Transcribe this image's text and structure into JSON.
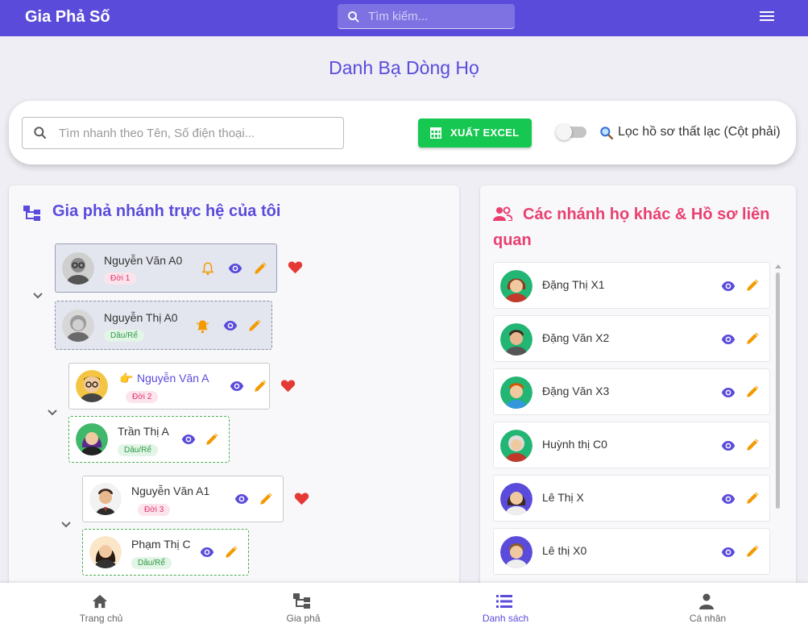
{
  "app": {
    "title": "Gia Phả Số",
    "search_placeholder": "Tìm kiếm..."
  },
  "page": {
    "title": "Danh Bạ Dòng Họ"
  },
  "toolbar": {
    "quick_search_placeholder": "Tìm nhanh theo Tên, Số điện thoại...",
    "excel_label": "XUẤT EXCEL",
    "filter_label": "Lọc hồ sơ thất lạc (Cột phải)",
    "filter_on": false
  },
  "tree": {
    "heading": "Gia phả nhánh trực hệ của tôi",
    "nodes": [
      {
        "name": "Nguyễn Văn A0",
        "badge": "Đời 1",
        "spouse_name": "Nguyễn Thị A0",
        "spouse_badge": "Dâu/Rể"
      },
      {
        "name": "Nguyễn Văn A",
        "pointer": "👉",
        "badge": "Đời 2",
        "spouse_name": "Trần Thị A",
        "spouse_badge": "Dâu/Rể"
      },
      {
        "name": "Nguyễn Văn A1",
        "badge": "Đời 3",
        "spouse_name": "Phạm Thị C",
        "spouse_badge": "Dâu/Rể"
      }
    ]
  },
  "related": {
    "heading": "Các nhánh họ khác & Hồ sơ liên quan",
    "items": [
      {
        "name": "Đặng Thị X1"
      },
      {
        "name": "Đặng Văn X2"
      },
      {
        "name": "Đặng Văn X3"
      },
      {
        "name": "Huỳnh thị C0"
      },
      {
        "name": "Lê Thị X"
      },
      {
        "name": "Lê thị X0"
      }
    ]
  },
  "nav": [
    {
      "label": "Trang chủ",
      "icon": "home-icon",
      "active": false
    },
    {
      "label": "Gia phả",
      "icon": "tree-icon",
      "active": false
    },
    {
      "label": "Danh sách",
      "icon": "list-icon",
      "active": true
    },
    {
      "label": "Cá nhân",
      "icon": "person-icon",
      "active": false
    }
  ],
  "colors": {
    "primary": "#5a4bdb",
    "accent_pink": "#e94070",
    "excel_green": "#16c751",
    "edit_orange": "#f29a00",
    "heart_red": "#e53935"
  }
}
